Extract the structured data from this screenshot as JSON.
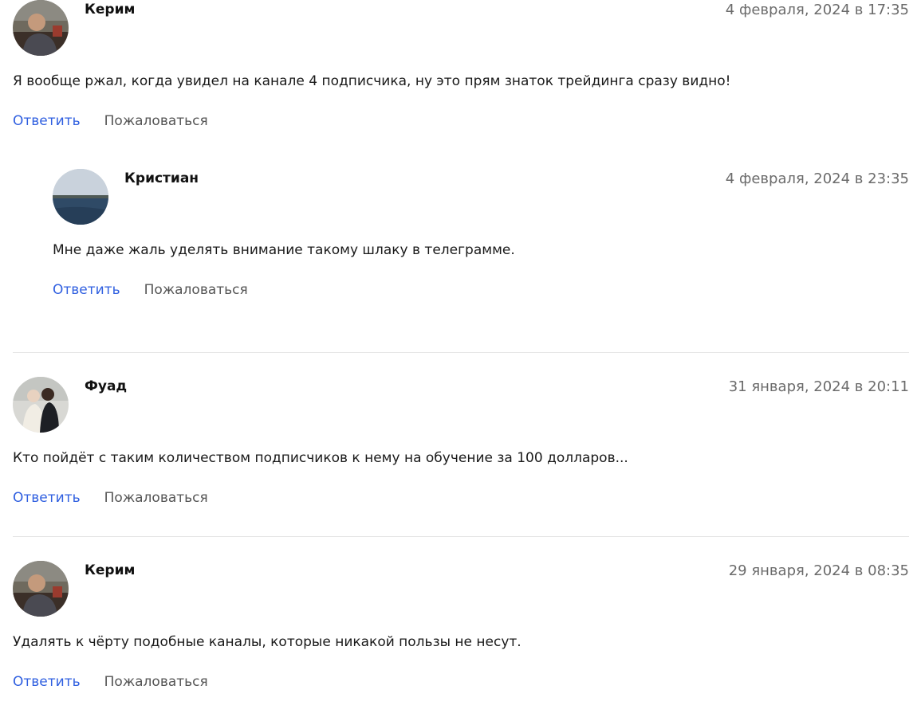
{
  "actions": {
    "reply_label": "Ответить",
    "report_label": "Пожаловаться"
  },
  "comments": [
    {
      "author": "Керим",
      "date": "4 февраля, 2024 в 17:35",
      "text": "Я вообще ржал, когда увидел на канале 4 подписчика, ну это прям знаток трейдинга сразу видно!",
      "avatar": "person-boat-avatar",
      "replies": [
        {
          "author": "Кристиан",
          "date": "4 февраля, 2024 в 23:35",
          "text": "Мне даже жаль уделять внимание такому шлаку в телеграмме.",
          "avatar": "lake-avatar"
        }
      ]
    },
    {
      "author": "Фуад",
      "date": "31 января, 2024 в 20:11",
      "text": "Кто пойдёт с таким количеством подписчиков к нему на обучение за 100 долларов...",
      "avatar": "couple-avatar"
    },
    {
      "author": "Керим",
      "date": "29 января, 2024 в 08:35",
      "text": "Удалять к чёрту подобные каналы, которые никакой пользы не несут.",
      "avatar": "person-boat-avatar"
    }
  ],
  "colors": {
    "link": "#2f5fe0",
    "muted": "#6b6b6b",
    "divider": "#e6e6e6"
  }
}
